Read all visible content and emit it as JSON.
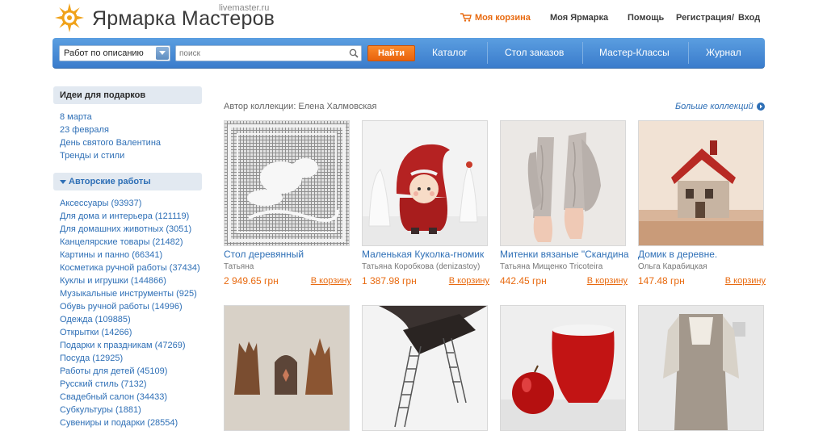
{
  "header": {
    "logo_title": "Ярмарка Мастеров",
    "logo_sub": "livemaster.ru",
    "cart": "Моя корзина",
    "my_fair": "Моя Ярмарка",
    "help": "Помощь",
    "register": "Регистрация",
    "separator": "/",
    "login": "Вход"
  },
  "search": {
    "mode_selected": "Работ по описанию",
    "placeholder": "поиск",
    "button": "Найти"
  },
  "main_nav": [
    "Каталог",
    "Стол заказов",
    "Мастер-Классы",
    "Журнал"
  ],
  "sidebar": {
    "ideas_title": "Идеи для подарков",
    "ideas": [
      "8 марта",
      "23 февраля",
      "День святого Валентина",
      "Тренды и стили"
    ],
    "works_title": "Авторские работы",
    "works": [
      "Аксессуары (93937)",
      "Для дома и интерьера (121119)",
      "Для домашних животных (3051)",
      "Канцелярские товары (21482)",
      "Картины и панно (66341)",
      "Косметика ручной работы (37434)",
      "Куклы и игрушки (144866)",
      "Музыкальные инструменты (925)",
      "Обувь ручной работы (14996)",
      "Одежда (109885)",
      "Открытки (14266)",
      "Подарки к праздникам (47269)",
      "Посуда (12925)",
      "Работы для детей (45109)",
      "Русский стиль (7132)",
      "Свадебный салон (34433)",
      "Субкультуры (1881)",
      "Сувениры и подарки (28554)"
    ]
  },
  "collection": {
    "author": "Автор коллекции: Елена Халмовская",
    "more": "Больше коллекций"
  },
  "products": [
    {
      "title": "Стол деревянный",
      "seller": "Татьяна",
      "price": "2 949.65 грн",
      "buy": "В корзину"
    },
    {
      "title": "Маленькая Куколка-гномик",
      "seller": "Татьяна Коробкова (denizastoy)",
      "price": "1 387.98 грн",
      "buy": "В корзину"
    },
    {
      "title": "Митенки вязаные \"Скандинавия\"",
      "seller": "Татьяна Мищенко Tricoteira",
      "price": "442.45 грн",
      "buy": "В корзину"
    },
    {
      "title": "Домик в деревне.",
      "seller": "Ольга Карабицкая",
      "price": "147.48 грн",
      "buy": "В корзину"
    }
  ],
  "colors": {
    "accent_orange": "#e86a10",
    "link_blue": "#2e6fb6",
    "bar_blue": "#4a8ad6"
  }
}
